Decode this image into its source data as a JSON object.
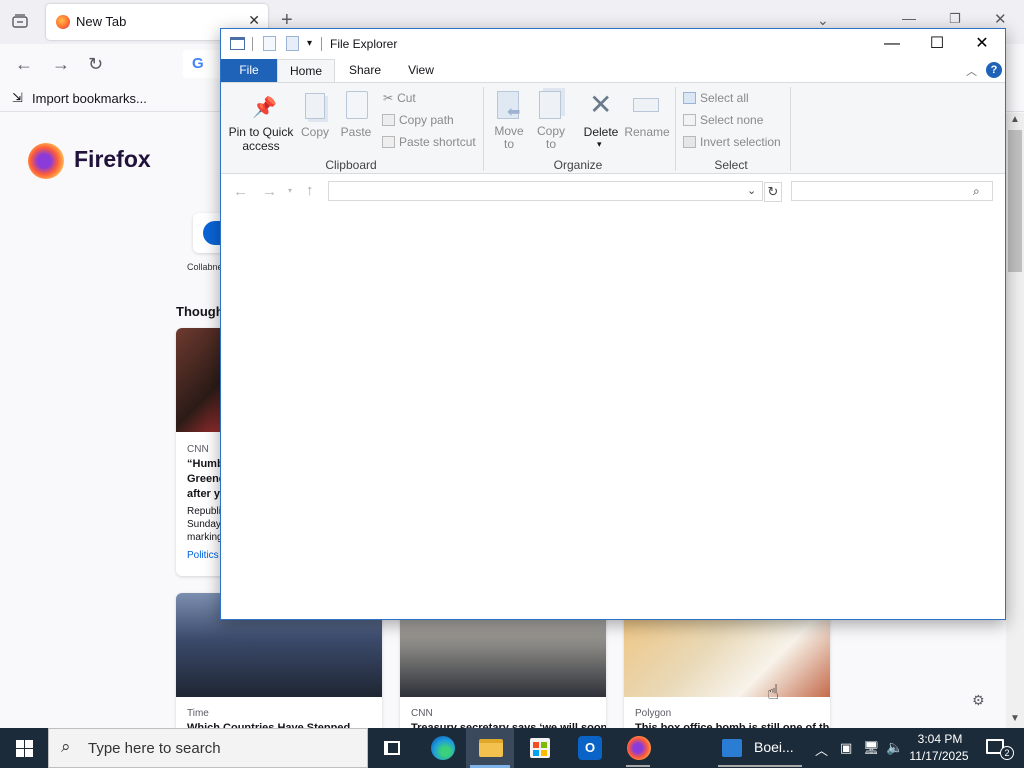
{
  "firefox": {
    "tab_title": "New Tab",
    "new_tab_symbol": "+",
    "import_bookmarks": "Import bookmarks...",
    "brand": "Firefox",
    "shortcut_label": "Collabne",
    "section_heading": "Thought",
    "cards": [
      {
        "source": "CNN",
        "headline": "“Humb\nGreene\nafter y",
        "excerpt": "Republic\nSunday\nmarking",
        "tag": "Politics"
      },
      {
        "source": "Time",
        "headline": "Which Countries Have Stepped"
      },
      {
        "source": "CNN",
        "headline": "Treasury secretary says ‘we will soon"
      },
      {
        "source": "Polygon",
        "headline": "This box office bomb is still one of the"
      }
    ]
  },
  "explorer": {
    "title": "File Explorer",
    "tabs": {
      "file": "File",
      "home": "Home",
      "share": "Share",
      "view": "View"
    },
    "clipboard": {
      "pin": "Pin to Quick\naccess",
      "copy": "Copy",
      "paste": "Paste",
      "cut": "Cut",
      "copy_path": "Copy path",
      "paste_shortcut": "Paste shortcut",
      "group": "Clipboard"
    },
    "organize": {
      "move_to": "Move\nto",
      "copy_to": "Copy\nto",
      "delete": "Delete",
      "rename": "Rename",
      "group": "Organize"
    },
    "select": {
      "select_all": "Select all",
      "select_none": "Select none",
      "invert": "Invert selection",
      "group": "Select"
    },
    "address_value": "",
    "search_placeholder": ""
  },
  "taskbar": {
    "search_placeholder": "Type here to search",
    "word_label": "Boei...",
    "time": "3:04 PM",
    "date": "11/17/2025",
    "notification_count": "2"
  },
  "colors": {
    "explorer_accent": "#1e63b8",
    "taskbar": "#1c2b3a"
  }
}
